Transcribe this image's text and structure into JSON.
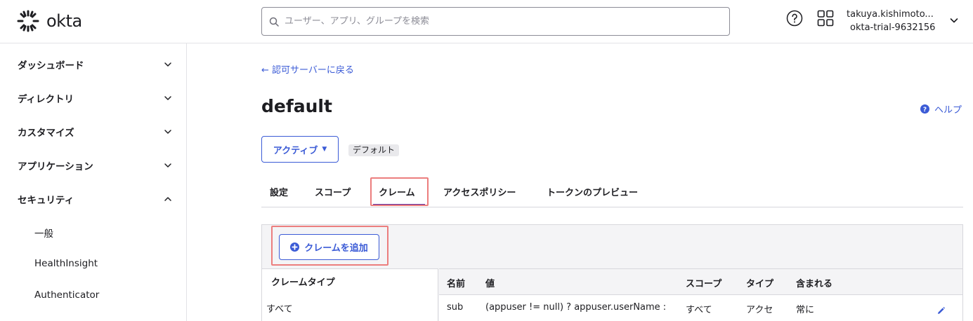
{
  "header": {
    "logo_text": "okta",
    "search_placeholder": "ユーザー、アプリ、グループを検索",
    "user_name": "takuya.kishimoto...",
    "org_name": "okta-trial-9632156",
    "icons": [
      "help-icon",
      "app-grid-icon",
      "chevron-down-icon"
    ]
  },
  "sidebar": {
    "items": [
      {
        "label": "ダッシュボード",
        "expanded": false
      },
      {
        "label": "ディレクトリ",
        "expanded": false
      },
      {
        "label": "カスタマイズ",
        "expanded": false
      },
      {
        "label": "アプリケーション",
        "expanded": false
      },
      {
        "label": "セキュリティ",
        "expanded": true
      }
    ],
    "sub_items": [
      "一般",
      "HealthInsight",
      "Authenticator"
    ]
  },
  "main": {
    "back_link": "← 認可サーバーに戻る",
    "title": "default",
    "help_label": "ヘルプ",
    "status_label": "アクティブ",
    "status_caret": "▼",
    "default_badge": "デフォルト",
    "tabs": [
      {
        "label": "設定"
      },
      {
        "label": "スコープ"
      },
      {
        "label": "クレーム",
        "active": true
      },
      {
        "label": "アクセスポリシー"
      },
      {
        "label": "トークンのプレビュー"
      }
    ],
    "add_claim_label": "クレームを追加",
    "claim_type_header": "クレームタイプ",
    "claim_type_all": "すべて",
    "table": {
      "columns": [
        "名前",
        "値",
        "スコープ",
        "タイプ",
        "含まれる"
      ],
      "rows": [
        {
          "name": "sub",
          "value": "(appuser != null) ? appuser.userName :",
          "scope": "すべて",
          "type": "アクセ",
          "included": "常に"
        }
      ]
    }
  },
  "colors": {
    "accent": "#3b5bd6",
    "active_tab_underline": "#5f2e9e",
    "highlight_box": "#ec7e7e"
  }
}
